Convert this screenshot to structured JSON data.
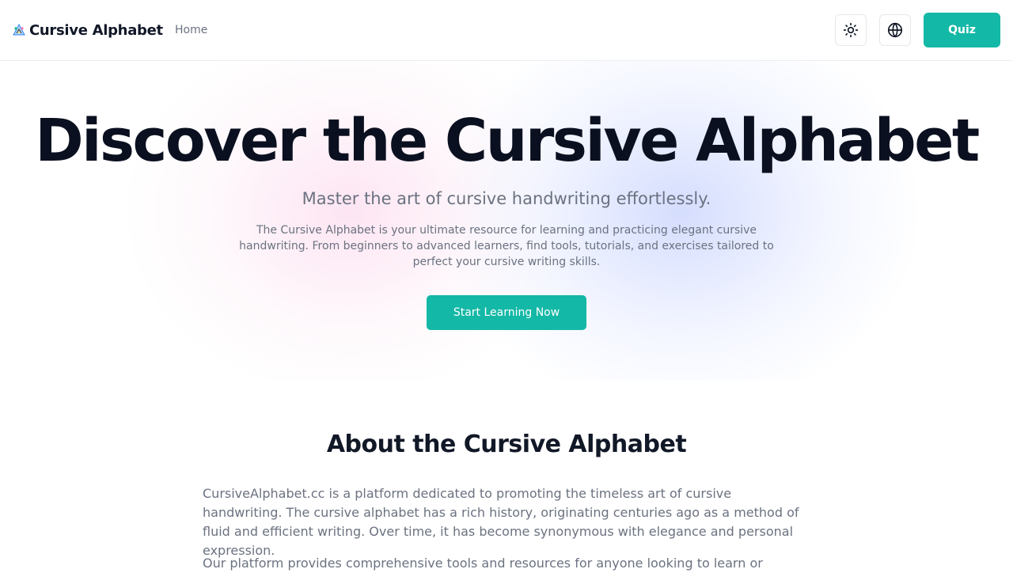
{
  "header": {
    "brand_name": "Cursive Alphabet",
    "brand_logo_icon": "alphabet-logo-icon",
    "nav_home": "Home",
    "theme_icon": "sun-icon",
    "language_icon": "globe-icon",
    "quiz_label": "Quiz"
  },
  "hero": {
    "title": "Discover the Cursive Alphabet",
    "subtitle": "Master the art of cursive handwriting effortlessly.",
    "description": "The Cursive Alphabet is your ultimate resource for learning and practicing elegant cursive handwriting. From beginners to advanced learners, find tools, tutorials, and exercises tailored to perfect your cursive writing skills.",
    "cta_label": "Start Learning Now"
  },
  "about": {
    "title": "About the Cursive Alphabet",
    "paragraph1": "CursiveAlphabet.cc is a platform dedicated to promoting the timeless art of cursive handwriting. The cursive alphabet has a rich history, originating centuries ago as a method of fluid and efficient writing. Over time, it has become synonymous with elegance and personal expression.",
    "paragraph2": "Our platform provides comprehensive tools and resources for anyone looking to learn or"
  },
  "colors": {
    "accent": "#14b8a6",
    "heading": "#111827",
    "muted_text": "#6b7280",
    "hero_glow_pink": "#fbcfe8",
    "hero_glow_blue": "#c7d2fe"
  }
}
